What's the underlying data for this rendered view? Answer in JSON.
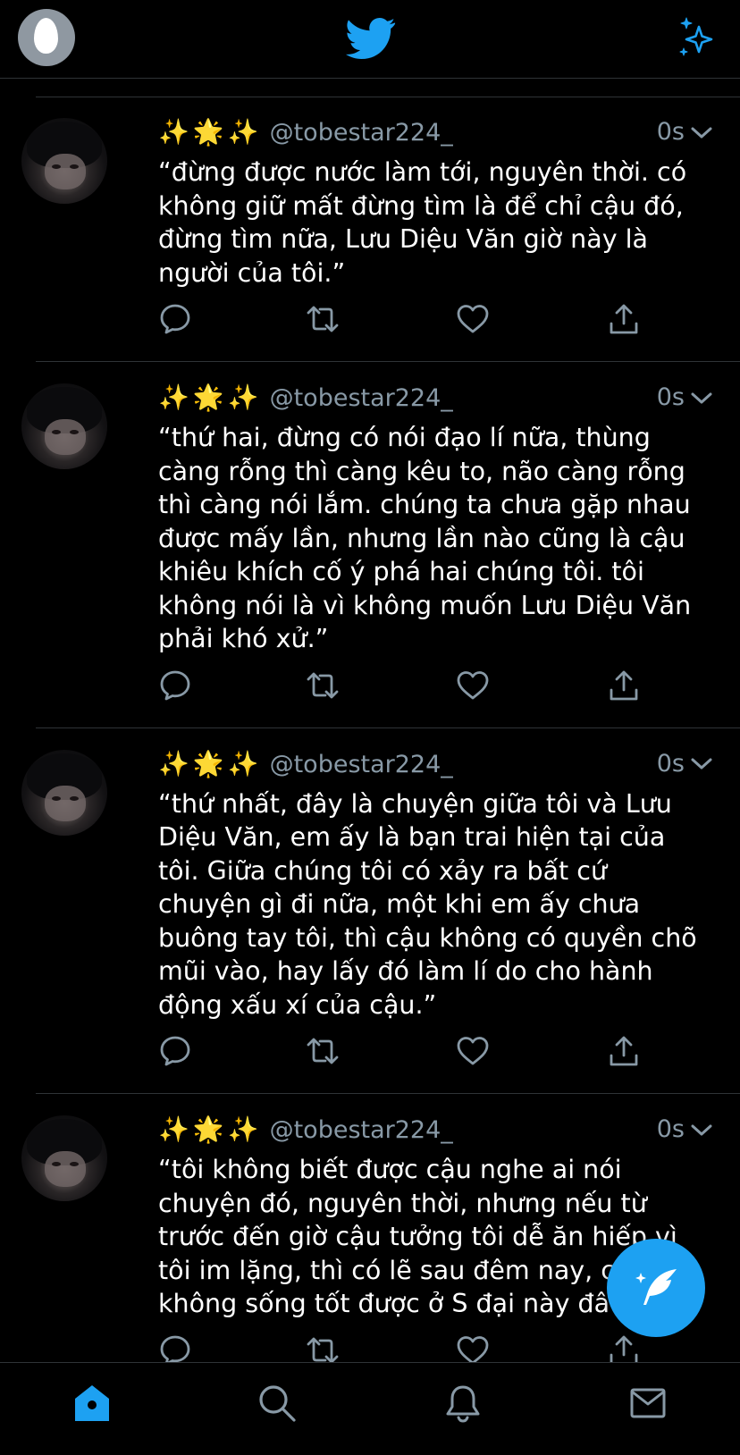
{
  "header": {
    "profile_icon": "egg-avatar-icon",
    "logo_icon": "twitter-bird-icon",
    "sparkle_icon": "sparkle-icon",
    "accent_color": "#1da1f2"
  },
  "tweets": [
    {
      "emoji": "✨🌟✨",
      "handle": "@tobestar224_",
      "time": "0s",
      "text": "“đừng được nước làm tới, nguyên thời. có không giữ mất đừng tìm là để chỉ cậu đó, đừng tìm nữa, Lưu Diệu Văn giờ này là người của tôi.”"
    },
    {
      "emoji": "✨🌟✨",
      "handle": "@tobestar224_",
      "time": "0s",
      "text": "“thứ hai, đừng có nói đạo lí nữa, thùng càng rỗng thì càng kêu to, não càng rỗng thì càng nói lắm. chúng ta chưa gặp nhau được mấy lần, nhưng lần nào cũng là cậu khiêu khích cố ý phá hai chúng tôi. tôi không nói là vì không muốn Lưu Diệu Văn phải khó xử.”"
    },
    {
      "emoji": "✨🌟✨",
      "handle": "@tobestar224_",
      "time": "0s",
      "text": "“thứ nhất, đây là chuyện giữa tôi và Lưu Diệu Văn, em ấy là bạn trai hiện tại của tôi. Giữa chúng tôi có xảy ra bất cứ chuyện gì đi nữa, một khi em ấy chưa buông tay tôi, thì cậu không có quyền chõ mũi vào, hay lấy đó làm lí do cho hành động xấu xí của cậu.”"
    },
    {
      "emoji": "✨🌟✨",
      "handle": "@tobestar224_",
      "time": "0s",
      "text": "“tôi không biết được cậu nghe ai nói chuyện đó, nguyên thời, nhưng nếu từ trước đến giờ cậu tưởng tôi dễ ăn hiếp vì tôi im lặng, thì có lẽ sau đêm nay, cậu sẽ không sống tốt được ở S đại này đâu.”"
    }
  ],
  "tabbar": {
    "items": [
      "home-icon",
      "search-icon",
      "bell-icon",
      "mail-icon"
    ],
    "active": "home-icon"
  }
}
